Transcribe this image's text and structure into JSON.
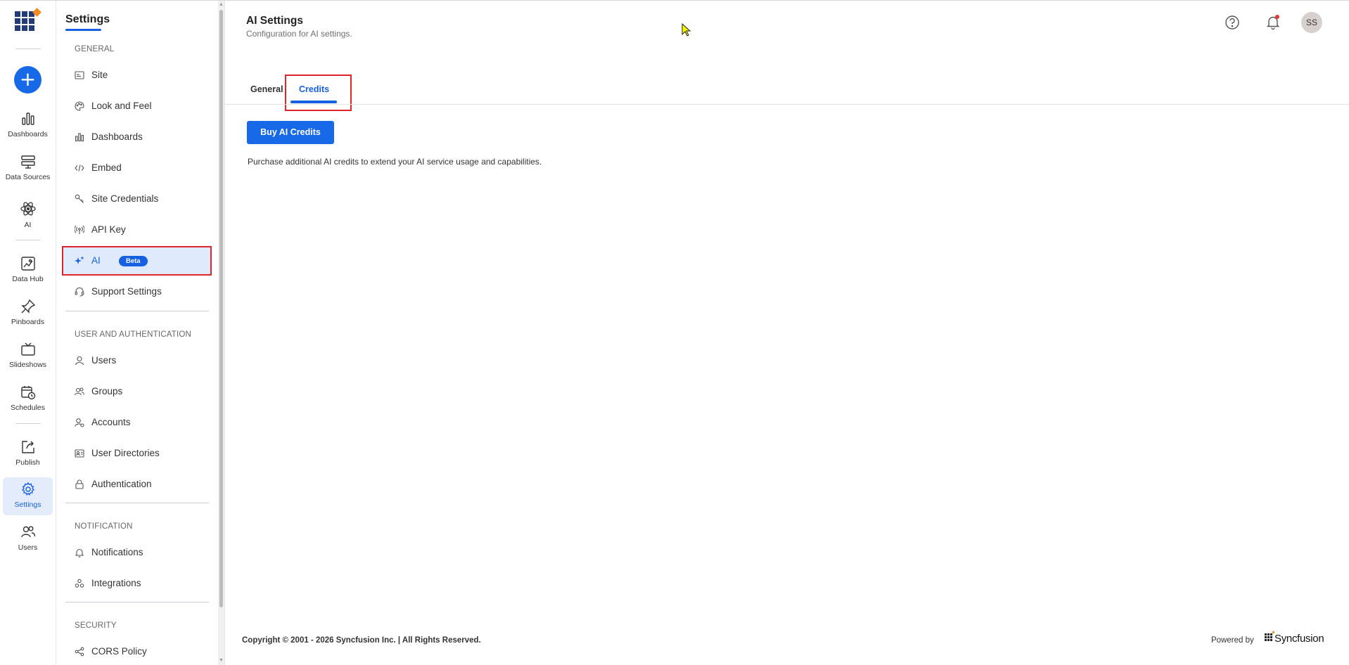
{
  "rail": {
    "items": [
      {
        "label": "Dashboards",
        "icon": "bar-chart-icon"
      },
      {
        "label": "Data Sources",
        "icon": "database-icon"
      },
      {
        "label": "AI",
        "icon": "atom-icon"
      },
      {
        "label": "Data Hub",
        "icon": "data-hub-icon"
      },
      {
        "label": "Pinboards",
        "icon": "pin-icon"
      },
      {
        "label": "Slideshows",
        "icon": "tv-icon"
      },
      {
        "label": "Schedules",
        "icon": "calendar-clock-icon"
      },
      {
        "label": "Publish",
        "icon": "publish-icon"
      },
      {
        "label": "Settings",
        "icon": "gear-icon",
        "active": true
      },
      {
        "label": "Users",
        "icon": "users-icon"
      }
    ],
    "create_label": "+"
  },
  "settings_nav": {
    "title": "Settings",
    "sections": [
      {
        "heading": "GENERAL",
        "items": [
          {
            "label": "Site",
            "icon": "site-icon"
          },
          {
            "label": "Look and Feel",
            "icon": "palette-icon"
          },
          {
            "label": "Dashboards",
            "icon": "bar-chart-icon"
          },
          {
            "label": "Embed",
            "icon": "code-icon"
          },
          {
            "label": "Site Credentials",
            "icon": "key-icon"
          },
          {
            "label": "API Key",
            "icon": "broadcast-icon"
          },
          {
            "label": "AI",
            "icon": "sparkle-icon",
            "badge": "Beta",
            "active": true
          },
          {
            "label": "Support Settings",
            "icon": "headset-icon"
          }
        ]
      },
      {
        "heading": "USER AND AUTHENTICATION",
        "items": [
          {
            "label": "Users",
            "icon": "user-icon"
          },
          {
            "label": "Groups",
            "icon": "group-icon"
          },
          {
            "label": "Accounts",
            "icon": "accounts-icon"
          },
          {
            "label": "User Directories",
            "icon": "directory-icon"
          },
          {
            "label": "Authentication",
            "icon": "lock-icon"
          }
        ]
      },
      {
        "heading": "NOTIFICATION",
        "items": [
          {
            "label": "Notifications",
            "icon": "bell-icon"
          },
          {
            "label": "Integrations",
            "icon": "integrations-icon"
          }
        ]
      },
      {
        "heading": "SECURITY",
        "items": [
          {
            "label": "CORS Policy",
            "icon": "share-icon"
          }
        ]
      }
    ]
  },
  "header": {
    "title": "AI Settings",
    "subtitle": "Configuration for AI settings.",
    "help_icon": "help-icon",
    "notification_icon": "bell-icon",
    "avatar_initials": "SS"
  },
  "tabs": [
    {
      "label": "General",
      "active": false
    },
    {
      "label": "Credits",
      "active": true
    }
  ],
  "credits": {
    "button_label": "Buy AI Credits",
    "description": "Purchase additional AI credits to extend your AI service usage and capabilities."
  },
  "footer": {
    "copyright": "Copyright © 2001 - 2026 Syncfusion Inc. | All Rights Reserved.",
    "powered_by": "Powered by",
    "brand": "Syncfusion"
  },
  "colors": {
    "accent": "#1661e3",
    "highlight_outline": "#e0242b",
    "active_bg": "#dfeafc",
    "logo_navy": "#243b7a",
    "logo_orange": "#f58a1f"
  }
}
